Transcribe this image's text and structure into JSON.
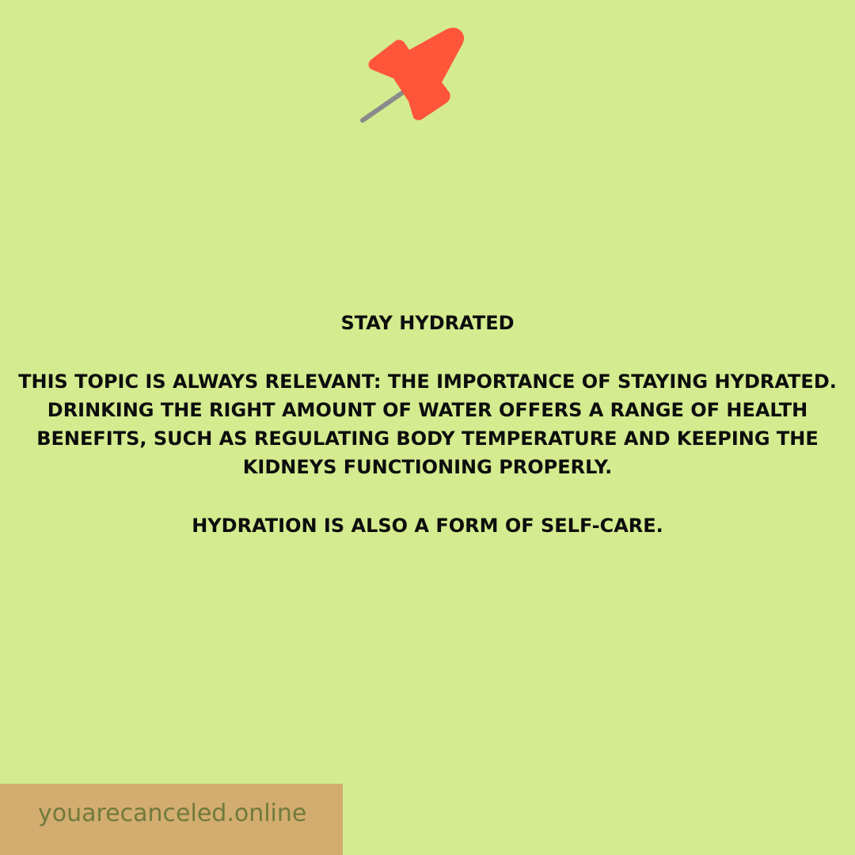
{
  "post": {
    "title": "STAY HYDRATED",
    "paragraph_1": "THIS TOPIC IS ALWAYS RELEVANT: THE IMPORTANCE OF STAYING HYDRATED. DRINKING THE RIGHT AMOUNT OF WATER OFFERS A RANGE OF HEALTH BENEFITS, SUCH AS REGULATING BODY TEMPERATURE AND KEEPING THE KIDNEYS FUNCTIONING PROPERLY.",
    "paragraph_2": "HYDRATION IS ALSO A FORM OF SELF-CARE."
  },
  "footer": {
    "site": "youarecanceled.online"
  },
  "icons": {
    "top": "pushpin-icon"
  },
  "colors": {
    "background": "#d4eb8f",
    "pin": "#ff5538",
    "pin_needle": "#8a8a8a",
    "footer": "#d2ad6f",
    "footer_text": "#6f7a3b",
    "text": "#0d0d0d"
  }
}
